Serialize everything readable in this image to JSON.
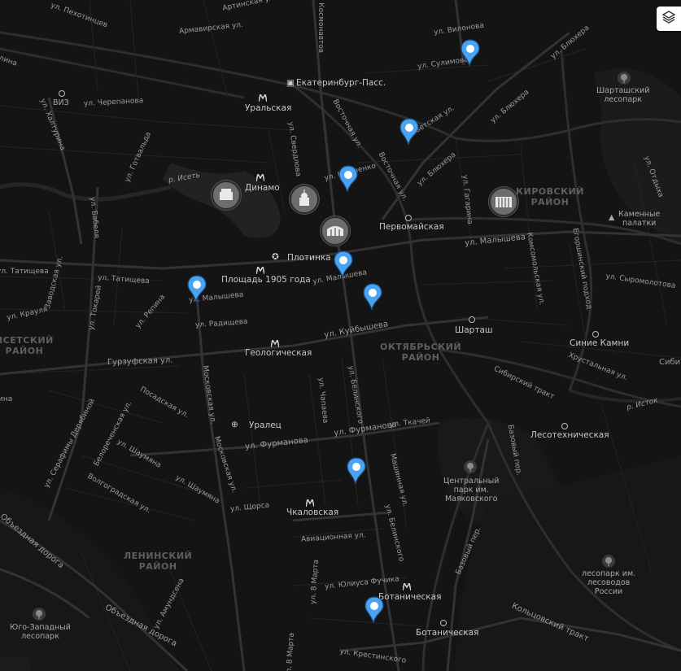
{
  "map": {
    "districts": {
      "kirovsky": [
        "КИРОВСКИЙ",
        "РАЙОН"
      ],
      "oktyabrsky": [
        "ОКТЯБРЬСКИЙ",
        "РАЙОН"
      ],
      "leninsky": [
        "ЛЕНИНСКИЙ",
        "РАЙОН"
      ],
      "verkh_isetsky": [
        "ИСЕТСКИЙ",
        "РАЙОН"
      ]
    },
    "metro_stations": {
      "uralskaya": "Уральская",
      "dinamo": "Динамо",
      "ploshchad_1905": "Площадь 1905 года",
      "geologicheskaya": "Геологическая",
      "chkalovskaya": "Чкаловская",
      "botanicheskaya": "Ботаническая"
    },
    "places": {
      "ekb_pass": "Екатеринбург-Пасс.",
      "viz": "ВИЗ",
      "plotinka": "Плотинка",
      "pervomayskaya": "Первомайская",
      "shartash": "Шарташ",
      "sinie_kamni": "Синие Камни",
      "uralets": "Уралец",
      "lesotekhnicheskaya": "Лесотехническая",
      "botanicheskaya_rail": "Ботаническая",
      "shartash_park": [
        "Шарташский",
        "лесопарк"
      ],
      "kamennye_palatki": [
        "Каменные",
        "палатки"
      ],
      "central_park": [
        "Центральный",
        "парк им.",
        "Маяковского"
      ],
      "lesopark_lesovodov": [
        "лесопарк им.",
        "лесоводов",
        "России"
      ],
      "yugo_zapadny": [
        "Юго-Западный",
        "лесопарк"
      ]
    },
    "streets": {
      "artinskaya": "Артинская ул.",
      "pekhotintsev": "ул. Пехотинцев",
      "armavirskaya": "Армавирская ул.",
      "kosmonavtov": "пр. Космонавтов",
      "vilonova": "ул. Вилонова",
      "sulimova": "ул. Сулимова",
      "blyukhera1": "ул. Блюхера",
      "blyukhera2": "ул. Блюхера",
      "blyukhera3": "ул. Блюхера",
      "cherepanova": "ул. Черепанова",
      "khlutkova": "ул. Халтурина",
      "gotvalda": "ул. Готвальда",
      "vostochnaya1": "Восточная ул.",
      "vostochnaya2": "Восточная ул.",
      "sovetskaya": "Советская ул.",
      "sverdlova": "ул. Свердлова",
      "iset": "р. Исеть",
      "shevchenko": "ул. Шевченко",
      "gagarina": "ул. Гагарина",
      "babelya": "ул. Бабеля",
      "malysheva1": "ул. Малышева",
      "malysheva2": "ул. Малышева",
      "malysheva3": "ул. Малышева",
      "tatishcheva1": "ул. Татищева",
      "tatishcheva2": "ул. Татищева",
      "zavodskaya": "Заводская ул.",
      "repina": "ул. Репина",
      "tokarey": "ул. Токарей",
      "krauly": "ул. Крауля",
      "radishcheva": "ул. Радищева",
      "kuybysheva": "ул. Куйбышева",
      "gurzufskaya": "Гурзуфская ул.",
      "posadskaya": "Посадская ул.",
      "serafimy": "ул. Серафимы Дерябиной",
      "belorechenskaya": "Белореченская ул.",
      "shaumyana1": "ул. Шаумяна",
      "shaumyana2": "ул. Шаумяна",
      "volgogradskaya": "Волгоградская ул.",
      "moskovskaya1": "Московская ул.",
      "moskovskaya2": "Московская ул.",
      "chapaeva": "ул. Чапаева",
      "belinskogo1": "ул. Белинского",
      "belinskogo2": "ул. Белинского",
      "furmanova1": "ул. Фурманова",
      "furmanova2": "ул. Фурманова",
      "tkachey": "ул. Ткачей",
      "mashinnaya": "Машинная ул.",
      "shchorsa": "ул. Щорса",
      "aviatsionnaya": "Авиационная ул.",
      "fuchika": "ул. Юлиуса Фучика",
      "vosmogo_marta1": "ул. 8 Марта",
      "vosmogo_marta2": "ул. 8 Марта",
      "krestinskogo": "ул. Крестинского",
      "bazovy1": "Базовый пер.",
      "bazovy2": "Базовый пер.",
      "koltsovsky": "Кольцовский тракт",
      "sibirsky": "Сибирский тракт",
      "khrustalnaya": "Хрустальная ул.",
      "istok": "р. Исток",
      "komsomolskaya": "Комсомольская ул.",
      "egorshinsky": "Егоршинский подход",
      "siromolotova": "ул. Сыромолотова",
      "otdykha": "ул. Отдыха",
      "obezdnaya1": "Объездная дорога",
      "obezdnaya2": "Объездная дорога",
      "amundsena": "ул. Амундсена",
      "sibir": "Сибир",
      "lina": "лина",
      "ina": "ина",
      "ulitsa_c": "ул.",
      "skogo": "ского"
    },
    "icons": {
      "layers": "layers-icon",
      "metro": "metro-icon",
      "pin": "location-pin-icon",
      "park": "park-icon"
    },
    "colors": {
      "pin": "#4aa3f0",
      "background": "#141415",
      "road": "#2b2b2d",
      "major_road": "#3a3a3c"
    }
  }
}
